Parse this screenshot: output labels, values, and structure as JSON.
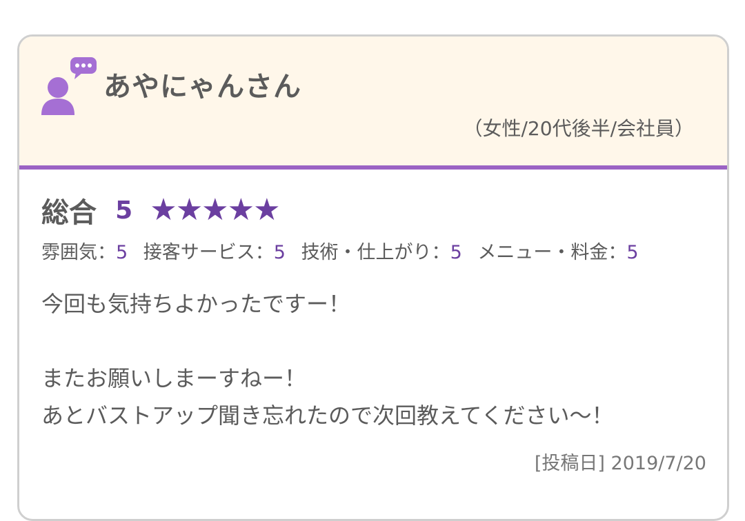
{
  "reviewer": {
    "name": "あやにゃんさん",
    "profile": "（女性/20代後半/会社員）"
  },
  "rating": {
    "overall_label": "総合",
    "overall_score": "5",
    "stars_filled": 5,
    "stars_total": 5,
    "categories": [
      {
        "label": "雰囲気：",
        "value": "5"
      },
      {
        "label": "接客サービス：",
        "value": "5"
      },
      {
        "label": "技術・仕上がり：",
        "value": "5"
      },
      {
        "label": "メニュー・料金：",
        "value": "5"
      }
    ]
  },
  "comment": {
    "lines": [
      "今回も気持ちよかったですー！",
      "",
      "またお願いしまーすねー！",
      "あとバストアップ聞き忘れたので次回教えてください〜！"
    ]
  },
  "post": {
    "date_label": "[投稿日]",
    "date": "2019/7/20"
  },
  "colors": {
    "accent": "#6b3fa0",
    "header_bg": "#fff7ea",
    "divider": "#9b63c4",
    "avatar": "#a56fd4"
  },
  "icons": {
    "avatar": "user-speech-icon",
    "star": "star-icon"
  }
}
